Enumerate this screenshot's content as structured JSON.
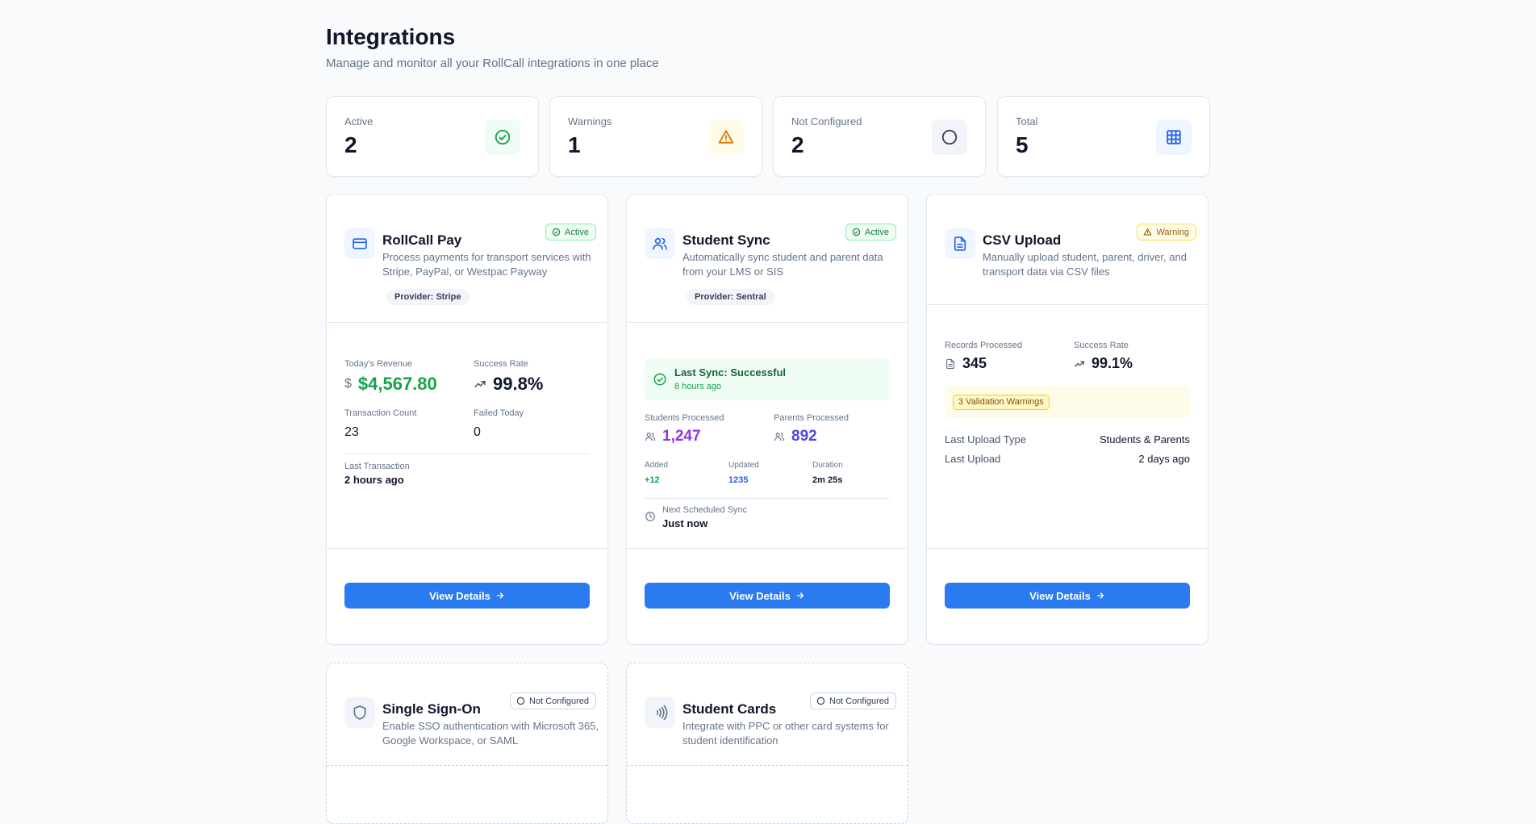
{
  "header": {
    "title": "Integrations",
    "subtitle": "Manage and monitor all your RollCall integrations in one place"
  },
  "stats": [
    {
      "label": "Active",
      "value": "2",
      "icon": "check-circle-icon",
      "color": "#16a34a",
      "bg": "#f0fdf4"
    },
    {
      "label": "Warnings",
      "value": "1",
      "icon": "warning-triangle-icon",
      "color": "#d97706",
      "bg": "#fefce8"
    },
    {
      "label": "Not Configured",
      "value": "2",
      "icon": "circle-icon",
      "color": "#334155",
      "bg": "#f1f5f9"
    },
    {
      "label": "Total",
      "value": "5",
      "icon": "grid-icon",
      "color": "#2563eb",
      "bg": "#eff6ff"
    }
  ],
  "pay": {
    "title": "RollCall Pay",
    "desc": "Process payments for transport services with Stripe, PayPal, or Westpac Payway",
    "badge": "Active",
    "provider": "Provider: Stripe",
    "revenue_label": "Today's Revenue",
    "currency_symbol": "$",
    "revenue": "$4,567.80",
    "success_label": "Success Rate",
    "success": "99.8%",
    "count_label": "Transaction Count",
    "count": "23",
    "failed_label": "Failed Today",
    "failed": "0",
    "last_label": "Last Transaction",
    "last": "2 hours ago",
    "button": "View Details"
  },
  "sync": {
    "title": "Student Sync",
    "desc": "Automatically sync student and parent data from your LMS or SIS",
    "badge": "Active",
    "provider": "Provider: Sentral",
    "last_sync": "Last Sync: Successful",
    "last_sync_time": "8 hours ago",
    "students_label": "Students Processed",
    "students": "1,247",
    "parents_label": "Parents Processed",
    "parents": "892",
    "added_label": "Added",
    "added": "+12",
    "updated_label": "Updated",
    "updated": "1235",
    "duration_label": "Duration",
    "duration": "2m 25s",
    "next_label": "Next Scheduled Sync",
    "next": "Just now",
    "button": "View Details"
  },
  "csv": {
    "title": "CSV Upload",
    "desc": "Manually upload student, parent, driver, and transport data via CSV files",
    "badge": "Warning",
    "records_label": "Records Processed",
    "records": "345",
    "success_label": "Success Rate",
    "success": "99.1%",
    "warnings": "3 Validation Warnings",
    "type_label": "Last Upload Type",
    "type": "Students & Parents",
    "upload_label": "Last Upload",
    "upload": "2 days ago",
    "button": "View Details"
  },
  "sso": {
    "title": "Single Sign-On",
    "desc": "Enable SSO authentication with Microsoft 365, Google Workspace, or SAML",
    "badge": "Not Configured"
  },
  "cards": {
    "title": "Student Cards",
    "desc": "Integrate with PPC or other card systems for student identification",
    "badge": "Not Configured"
  },
  "colors": {
    "accent": "#2b7bf0",
    "green": "#16a34a",
    "purple": "#9333ea",
    "indigo": "#4f46e5"
  }
}
